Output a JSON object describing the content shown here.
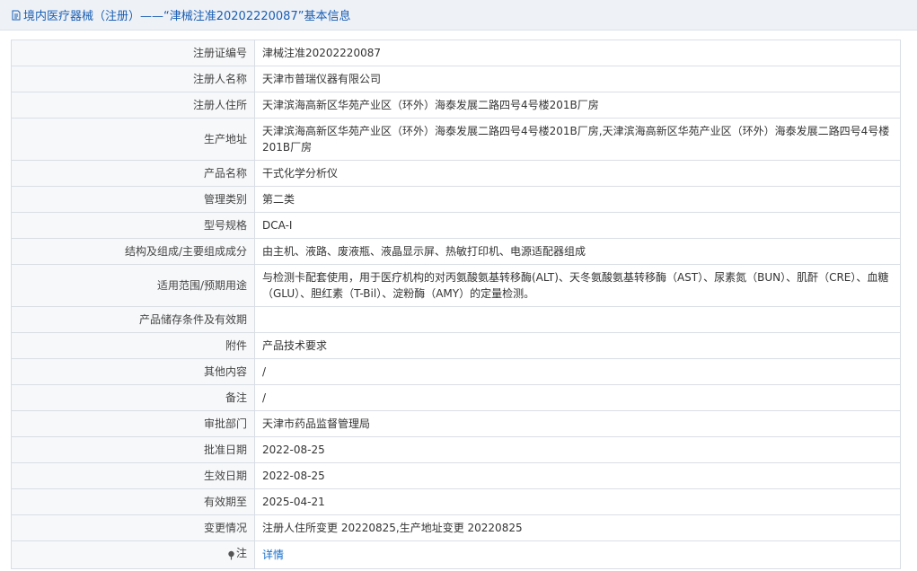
{
  "header": {
    "title": "境内医疗器械（注册）——“津械注准20202220087”基本信息"
  },
  "rows": [
    {
      "label": "注册证编号",
      "value": "津械注准20202220087"
    },
    {
      "label": "注册人名称",
      "value": "天津市普瑞仪器有限公司"
    },
    {
      "label": "注册人住所",
      "value": "天津滨海高新区华苑产业区（环外）海泰发展二路四号4号楼201B厂房"
    },
    {
      "label": "生产地址",
      "value": "天津滨海高新区华苑产业区（环外）海泰发展二路四号4号楼201B厂房,天津滨海高新区华苑产业区（环外）海泰发展二路四号4号楼201B厂房"
    },
    {
      "label": "产品名称",
      "value": "干式化学分析仪"
    },
    {
      "label": "管理类别",
      "value": "第二类"
    },
    {
      "label": "型号规格",
      "value": "DCA-I"
    },
    {
      "label": "结构及组成/主要组成成分",
      "value": "由主机、液路、废液瓶、液晶显示屏、热敏打印机、电源适配器组成"
    },
    {
      "label": "适用范围/预期用途",
      "value": "与检测卡配套使用，用于医疗机构的对丙氨酸氨基转移酶(ALT)、天冬氨酸氨基转移酶（AST）、尿素氮（BUN）、肌酐（CRE）、血糖（GLU）、胆红素（T-Bil）、淀粉酶（AMY）的定量检测。"
    },
    {
      "label": "产品储存条件及有效期",
      "value": ""
    },
    {
      "label": "附件",
      "value": "产品技术要求"
    },
    {
      "label": "其他内容",
      "value": "/"
    },
    {
      "label": "备注",
      "value": "/"
    },
    {
      "label": "审批部门",
      "value": "天津市药品监督管理局"
    },
    {
      "label": "批准日期",
      "value": "2022-08-25"
    },
    {
      "label": "生效日期",
      "value": "2022-08-25"
    },
    {
      "label": "有效期至",
      "value": "2025-04-21"
    },
    {
      "label": "变更情况",
      "value": "注册人住所变更 20220825,生产地址变更 20220825"
    }
  ],
  "note": {
    "label": "注",
    "link": "详情",
    "icon": "pin-icon"
  }
}
